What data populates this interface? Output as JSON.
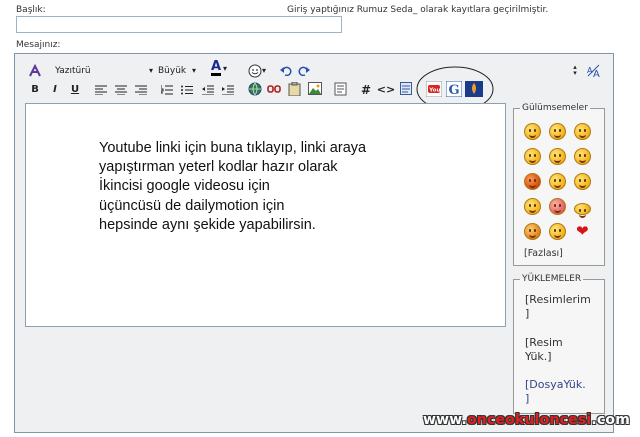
{
  "form": {
    "title_label": "Başlık:",
    "title_value": "",
    "nickname_notice": "Giriş yaptığınız Rumuz Seda_ olarak kayıtlara geçirilmiştir.",
    "message_label": "Mesajınız:"
  },
  "toolbar": {
    "font_select": "Yazıtürü",
    "size_select": "Büyük",
    "color_label": "A",
    "bold": "B",
    "italic": "I",
    "underline": "U",
    "hash": "#",
    "code": "<>",
    "youtube_icon": "youtube-icon",
    "google_video_icon": "google-video-icon",
    "dailymotion_icon": "dailymotion-icon"
  },
  "editor": {
    "lines": [
      "Youtube linki için buna tıklayıp, linki araya",
      "yapıştırman yeterl kodlar hazır olarak",
      "İkincisi google videosu için",
      "üçüncüsü de dailymotion için",
      "hepsinde aynı şekide yapabilirsin."
    ]
  },
  "smileys": {
    "legend": "Gülümsemeler",
    "more": "[Fazlası]"
  },
  "uploads": {
    "legend": "YÜKLEMELER",
    "images": "[Resimlerim\n]",
    "image_upload": "[Resim\nYük.]",
    "file_upload": "[DosyaYük.\n]"
  },
  "watermark": {
    "prefix": "www.",
    "brand": "onceokuloncesi",
    "suffix": ".com"
  },
  "colors": {
    "frame_border": "#7f95aa",
    "editor_bg": "#eef0f2",
    "annotation_line": "#333333",
    "watermark_red": "#e02020"
  }
}
